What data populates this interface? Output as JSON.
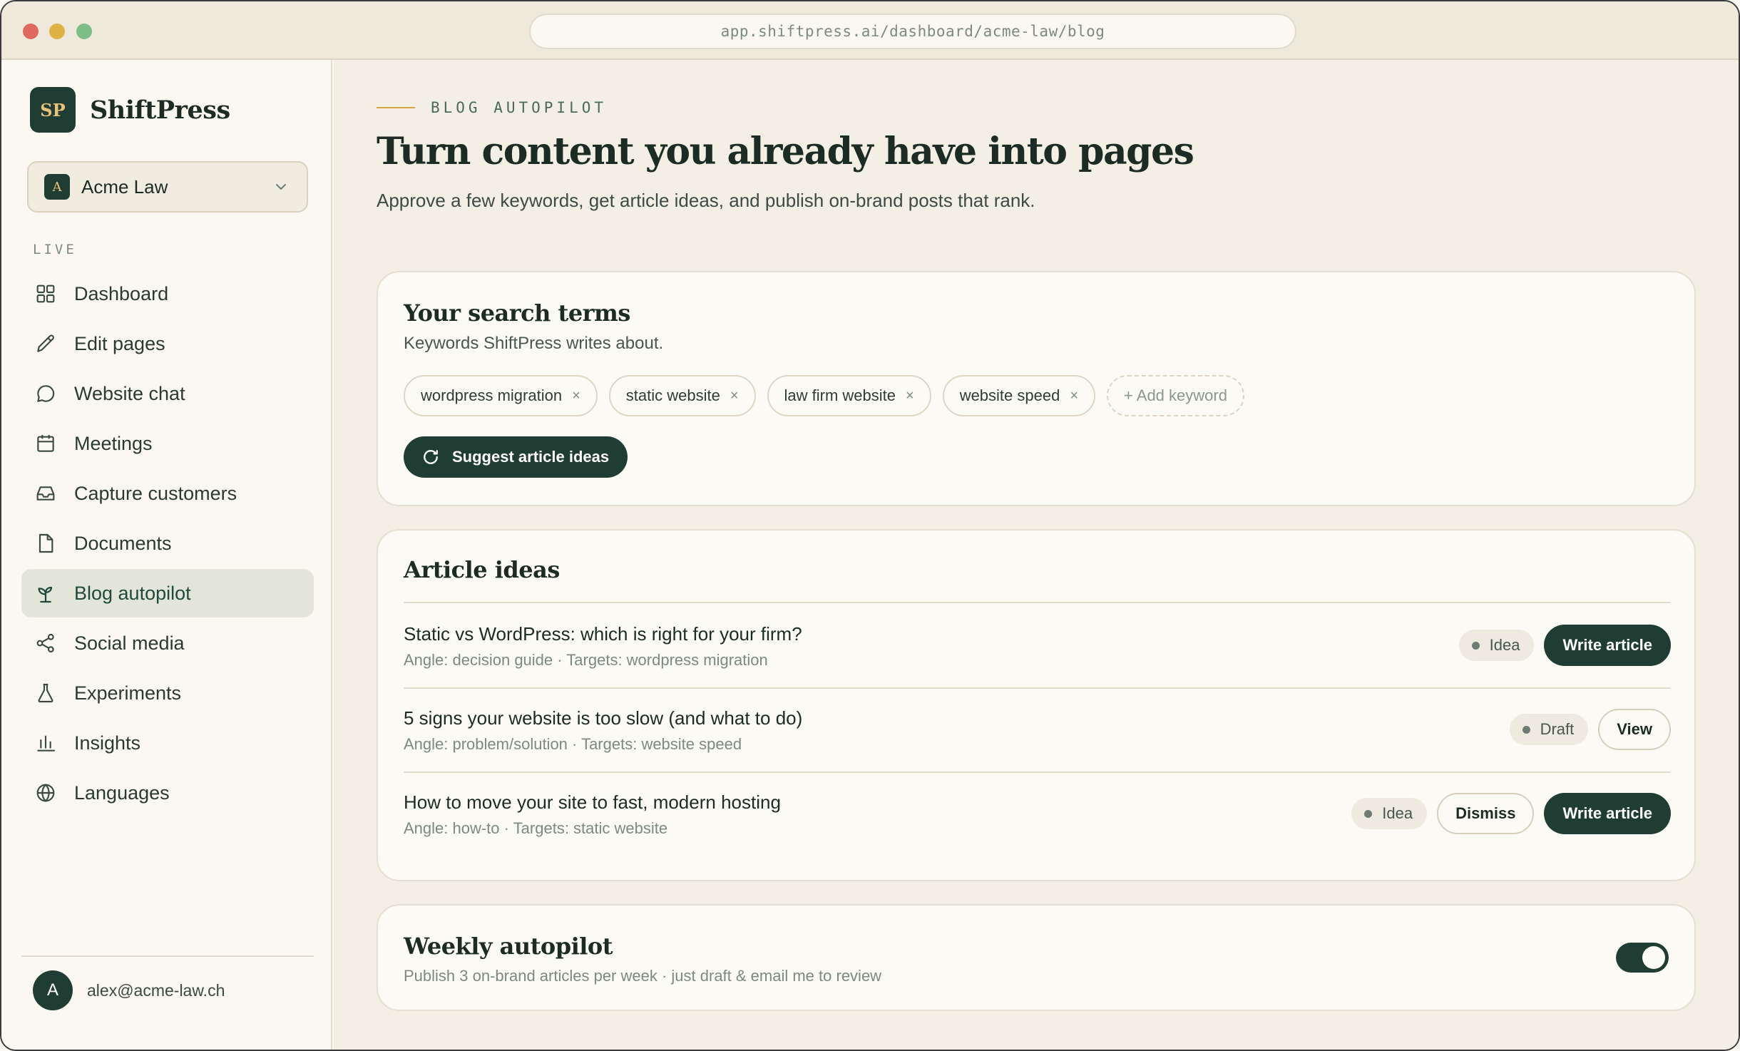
{
  "browser": {
    "url": "app.shiftpress.ai/dashboard/acme-law/blog"
  },
  "brand": {
    "logo_text": "SP",
    "name": "ShiftPress"
  },
  "workspace": {
    "avatar_letter": "A",
    "name": "Acme Law"
  },
  "sidebar": {
    "section_label": "LIVE",
    "items": [
      {
        "label": "Dashboard",
        "icon": "grid-icon"
      },
      {
        "label": "Edit pages",
        "icon": "pencil-icon"
      },
      {
        "label": "Website chat",
        "icon": "chat-icon"
      },
      {
        "label": "Meetings",
        "icon": "calendar-icon"
      },
      {
        "label": "Capture customers",
        "icon": "inbox-icon"
      },
      {
        "label": "Documents",
        "icon": "document-icon"
      },
      {
        "label": "Blog autopilot",
        "icon": "seedling-icon",
        "active": true
      },
      {
        "label": "Social media",
        "icon": "share-icon"
      },
      {
        "label": "Experiments",
        "icon": "flask-icon"
      },
      {
        "label": "Insights",
        "icon": "bar-chart-icon"
      },
      {
        "label": "Languages",
        "icon": "globe-icon"
      }
    ],
    "user": {
      "avatar_letter": "A",
      "email": "alex@acme-law.ch"
    }
  },
  "header": {
    "eyebrow": "BLOG AUTOPILOT",
    "title": "Turn content you already have into pages",
    "subtitle": "Approve a few keywords, get article ideas, and publish on-brand posts that rank."
  },
  "search_terms": {
    "title": "Your search terms",
    "subtitle": "Keywords ShiftPress writes about.",
    "keywords": [
      "wordpress migration",
      "static website",
      "law firm website",
      "website speed"
    ],
    "remove_glyph": "×",
    "add_label": "+ Add keyword",
    "suggest_label": "Suggest article ideas"
  },
  "article_ideas": {
    "title": "Article ideas",
    "items": [
      {
        "title": "Static vs WordPress: which is right for your firm?",
        "meta": "Angle: decision guide · Targets: wordpress migration",
        "status": "Idea",
        "actions": [
          "Write article"
        ]
      },
      {
        "title": "5 signs your website is too slow (and what to do)",
        "meta": "Angle: problem/solution · Targets: website speed",
        "status": "Draft",
        "actions": [
          "View"
        ]
      },
      {
        "title": "How to move your site to fast, modern hosting",
        "meta": "Angle: how-to · Targets: static website",
        "status": "Idea",
        "actions": [
          "Dismiss",
          "Write article"
        ]
      }
    ]
  },
  "weekly_autopilot": {
    "title": "Weekly autopilot",
    "subtitle": "Publish 3 on-brand articles per week · just draft & email me to review",
    "enabled": true
  },
  "colors": {
    "brand_dark_green": "#1f3d33",
    "accent_gold": "#d7a646",
    "background": "#f4efe4"
  }
}
